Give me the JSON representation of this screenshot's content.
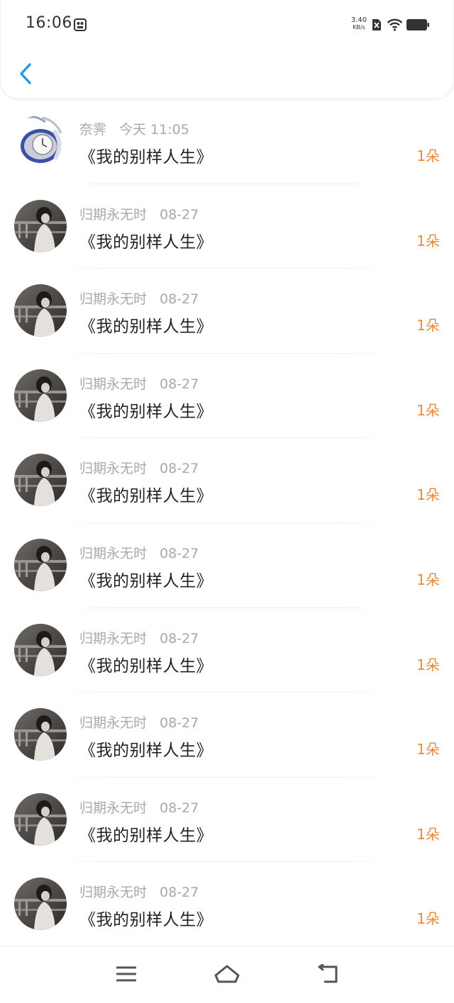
{
  "status_bar": {
    "time": "16:06",
    "net_speed_value": "3.40",
    "net_speed_unit": "KB/s",
    "icons": [
      "screen-record-icon",
      "sim-x-icon",
      "wifi-icon",
      "battery-icon"
    ]
  },
  "header": {
    "back_icon": "chevron-left-icon",
    "accent_color": "#2b96e8"
  },
  "list": {
    "count_color": "#ec8a37",
    "items": [
      {
        "name": "奈霁",
        "time": "今天 11:05",
        "title": "《我的别样人生》",
        "count": "1朵",
        "avatar": "watch-avatar"
      },
      {
        "name": "归期永无时",
        "time": "08-27",
        "title": "《我的别样人生》",
        "count": "1朵",
        "avatar": "photo-avatar"
      },
      {
        "name": "归期永无时",
        "time": "08-27",
        "title": "《我的别样人生》",
        "count": "1朵",
        "avatar": "photo-avatar"
      },
      {
        "name": "归期永无时",
        "time": "08-27",
        "title": "《我的别样人生》",
        "count": "1朵",
        "avatar": "photo-avatar"
      },
      {
        "name": "归期永无时",
        "time": "08-27",
        "title": "《我的别样人生》",
        "count": "1朵",
        "avatar": "photo-avatar"
      },
      {
        "name": "归期永无时",
        "time": "08-27",
        "title": "《我的别样人生》",
        "count": "1朵",
        "avatar": "photo-avatar"
      },
      {
        "name": "归期永无时",
        "time": "08-27",
        "title": "《我的别样人生》",
        "count": "1朵",
        "avatar": "photo-avatar"
      },
      {
        "name": "归期永无时",
        "time": "08-27",
        "title": "《我的别样人生》",
        "count": "1朵",
        "avatar": "photo-avatar"
      },
      {
        "name": "归期永无时",
        "time": "08-27",
        "title": "《我的别样人生》",
        "count": "1朵",
        "avatar": "photo-avatar"
      },
      {
        "name": "归期永无时",
        "time": "08-27",
        "title": "《我的别样人生》",
        "count": "1朵",
        "avatar": "photo-avatar"
      }
    ]
  },
  "nav_bar": {
    "icons": [
      "menu-icon",
      "home-icon",
      "back-icon"
    ]
  }
}
